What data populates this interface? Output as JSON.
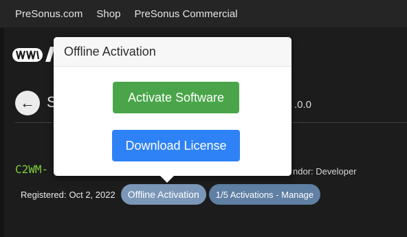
{
  "nav": {
    "links": [
      "PreSonus.com",
      "Shop",
      "PreSonus Commercial"
    ]
  },
  "page": {
    "title_fragment": "S",
    "version_fragment": ".0.0",
    "serial_fragment": "C2WM-",
    "vendor_fragment": "ndor: Developer",
    "registered_label": "Registered:",
    "registered_date": "Oct 2, 2022",
    "offline_pill": "Offline Activation",
    "activations_pill": "1/5 Activations - Manage"
  },
  "popover": {
    "title": "Offline Activation",
    "activate_label": "Activate Software",
    "download_label": "Download License"
  },
  "icons": {
    "back": "arrow-left-icon",
    "logo": "presonus-logo"
  },
  "colors": {
    "activate": "#4aa54a",
    "download": "#2e82f5",
    "serial": "#7fce3a",
    "pill": "#7b97b8"
  }
}
